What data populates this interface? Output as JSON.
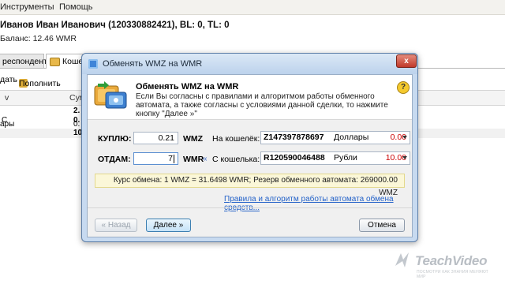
{
  "menu": {
    "tools": "Инструменты",
    "help": "Помощь"
  },
  "account": {
    "title": "Иванов Иван Иванович (120330882421), BL: 0, TL: 0",
    "balance": "Баланс: 12.46 WMR"
  },
  "tabs": [
    {
      "label": "респонденты"
    },
    {
      "label": "Кошел"
    }
  ],
  "toolbar": {
    "create": "дать",
    "topup": "Пополнить"
  },
  "table": {
    "col1": "v",
    "col2": "Сум",
    "rows": [
      {
        "name": "",
        "value": "2."
      },
      {
        "name": "C",
        "value": "0."
      },
      {
        "name": "ары",
        "value": "0."
      },
      {
        "name": "",
        "value": "10."
      }
    ]
  },
  "dialog": {
    "title": "Обменять WMZ на  WMR",
    "close": "x",
    "header_title": "Обменять WMZ на  WMR",
    "header_text": "Если Вы согласны с правилами и алгоритмом работы обменного автомата, а также согласны с условиями данной сделки, то нажмите кнопку \"Далее »\"",
    "buy": {
      "label": "КУПЛЮ:",
      "value": "0.21",
      "currency": "WMZ",
      "purse_label": "На кошелёк:",
      "purse": "Z147397878697",
      "purse_currency": "Доллары",
      "purse_amount": "0.00"
    },
    "give": {
      "label": "ОТДАМ:",
      "value": "7",
      "currency": "WMR",
      "arrow": "«",
      "purse_label": "С кошелька:",
      "purse": "R120590046488",
      "purse_currency": "Рубли",
      "purse_amount": "10.00"
    },
    "rate": "Курс обмена: 1 WMZ = 31.6498 WMR; Резерв обменного автомата: 269000.00 WMZ",
    "rules_link": "Правила и алгоритм работы автомата обмена средств...",
    "back": "« Назад",
    "next": "Далее »",
    "cancel": "Отмена"
  },
  "watermark": {
    "name": "TeachVideo",
    "tagline": "ПОСМОТРИ КАК ЗНАНИЯ МЕНЯЮТ МИР"
  },
  "colors": {
    "dialog_frame": "#c7daf0",
    "rate_bg": "#fbf7d8",
    "link": "#2563c9",
    "amount_red": "#cc0000"
  }
}
